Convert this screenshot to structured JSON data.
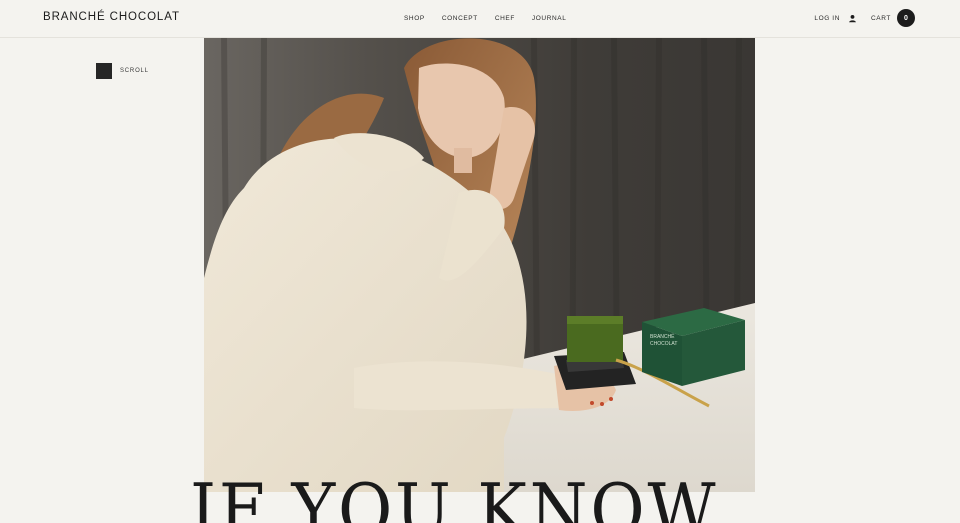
{
  "header": {
    "brand": "BRANCHÉ CHOCOLAT",
    "nav": [
      "SHOP",
      "CONCEPT",
      "CHEF",
      "JOURNAL"
    ],
    "login_label": "LOG IN",
    "login_icon": "user-icon",
    "cart_label": "CART",
    "cart_count": "0"
  },
  "scroll": {
    "label": "SCROLL"
  },
  "hero": {
    "package_text_line1": "BRANCHÉ",
    "package_text_line2": "CHOCOLAT"
  },
  "headline": "IF YOU KNOW",
  "colors": {
    "background": "#f4f3ef",
    "text": "#1f1f1f",
    "package_green": "#1f5236",
    "cake_green": "#4a6a1f"
  }
}
